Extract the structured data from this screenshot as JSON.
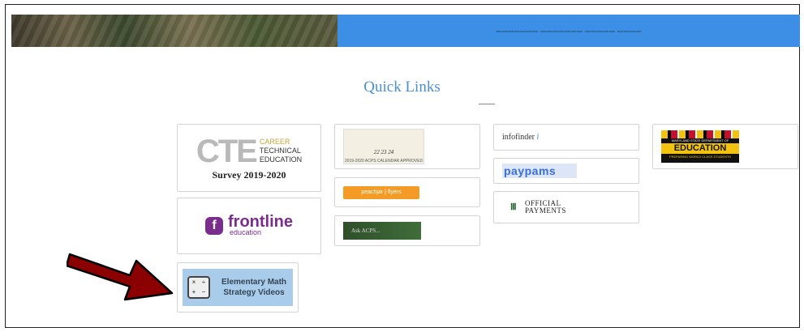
{
  "banner": {
    "nav_text": "▬▬▬▬▬▬▬ ▬▬▬▬▬▬▬ ▬▬▬▬▬ ▬▬▬▬"
  },
  "quick_links": {
    "title": "Quick Links",
    "tiles": {
      "cte": {
        "big": "CTE",
        "line1": "CAREER",
        "line2": "TECHNICAL",
        "line3": "EDUCATION",
        "survey": "Survey 2019-2020"
      },
      "frontline": {
        "logo": "f",
        "name": "frontline",
        "sub": "education"
      },
      "math": {
        "line1": "Elementary Math",
        "line2": "Strategy Videos"
      },
      "calendar": {
        "nums": "22  23  24",
        "caption": "2019-2020 ACPS CALENDAR APPROVED"
      },
      "peachjar": {
        "label": "peachjar | flyers"
      },
      "ask": {
        "label": "Ask ACPS..."
      },
      "infofinder": {
        "label": "infofinder",
        "mark": "i"
      },
      "paypams": {
        "label": "paypams"
      },
      "official": {
        "line1": "OFFICIAL",
        "line2": "PAYMENTS"
      },
      "msde": {
        "top": "MARYLAND STATE DEPARTMENT OF",
        "big": "EDUCATION",
        "tag": "PREPARING WORLD CLASS STUDENTS"
      }
    }
  },
  "colors": {
    "banner_blue": "#3d8fe6",
    "title_blue": "#4a90d9",
    "arrow_red": "#8b0000"
  },
  "icons": {
    "arrow": "pointer-arrow-icon"
  }
}
